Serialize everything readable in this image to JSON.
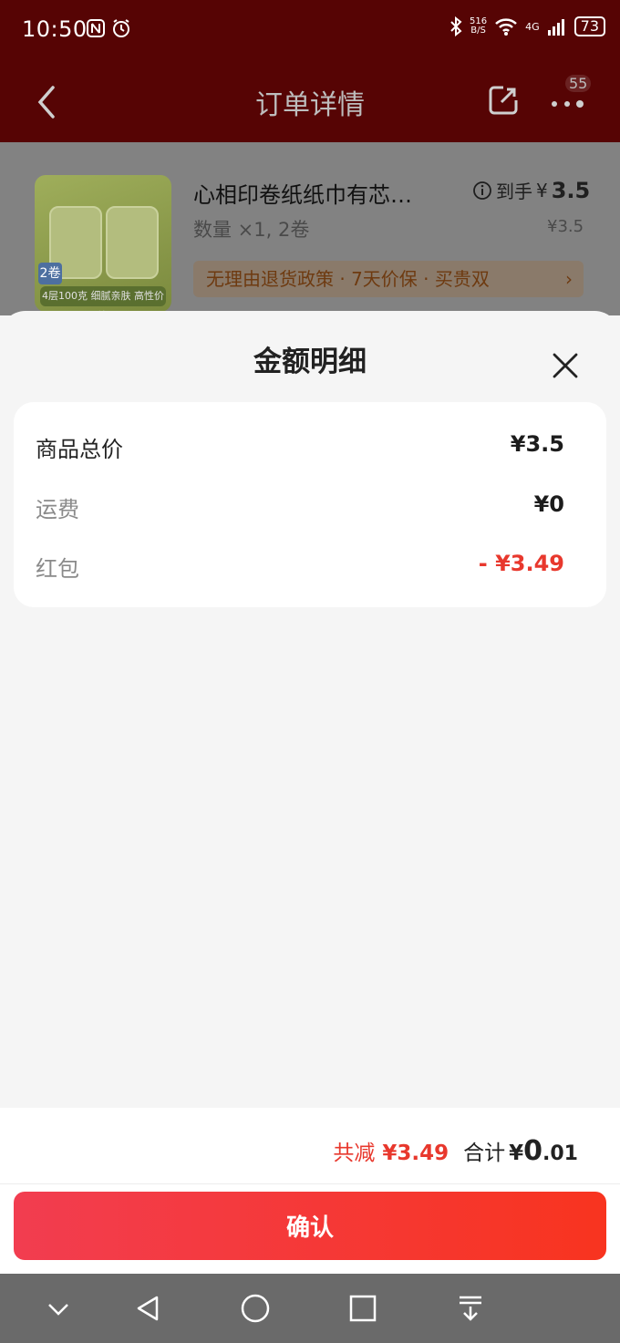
{
  "status_bar": {
    "time": "10:50",
    "net_speed_top": "516",
    "net_speed_bottom": "B/S",
    "network_type": "4G",
    "battery": "73"
  },
  "nav": {
    "title": "订单详情",
    "more_badge": "55"
  },
  "product": {
    "title": "心相印卷纸纸巾有芯…",
    "price_prefix": "到手",
    "price_symbol": "¥",
    "price": "3.5",
    "quantity": "数量 ×1, 2卷",
    "original_price": "¥3.5",
    "policy": "无理由退货政策 · 7天价保 · 买贵双",
    "thumb_tag": "4层100克 细腻亲肤 高性价比",
    "thumb_badge": "2卷"
  },
  "sheet": {
    "title": "金额明细",
    "rows": [
      {
        "label": "商品总价",
        "value": "¥3.5"
      },
      {
        "label": "运费",
        "value": "¥0"
      },
      {
        "label": "红包",
        "value": "- ¥3.49"
      }
    ]
  },
  "summary": {
    "discount_label": "共减",
    "discount_value": "¥3.49",
    "total_label": "合计",
    "total_symbol": "¥",
    "total_int": "0",
    "total_dec": ".01"
  },
  "confirm_label": "确认",
  "colors": {
    "accent_red": "#e8382d",
    "header_bg": "#560404",
    "button_start": "#f23d50",
    "button_end": "#f8341f"
  }
}
